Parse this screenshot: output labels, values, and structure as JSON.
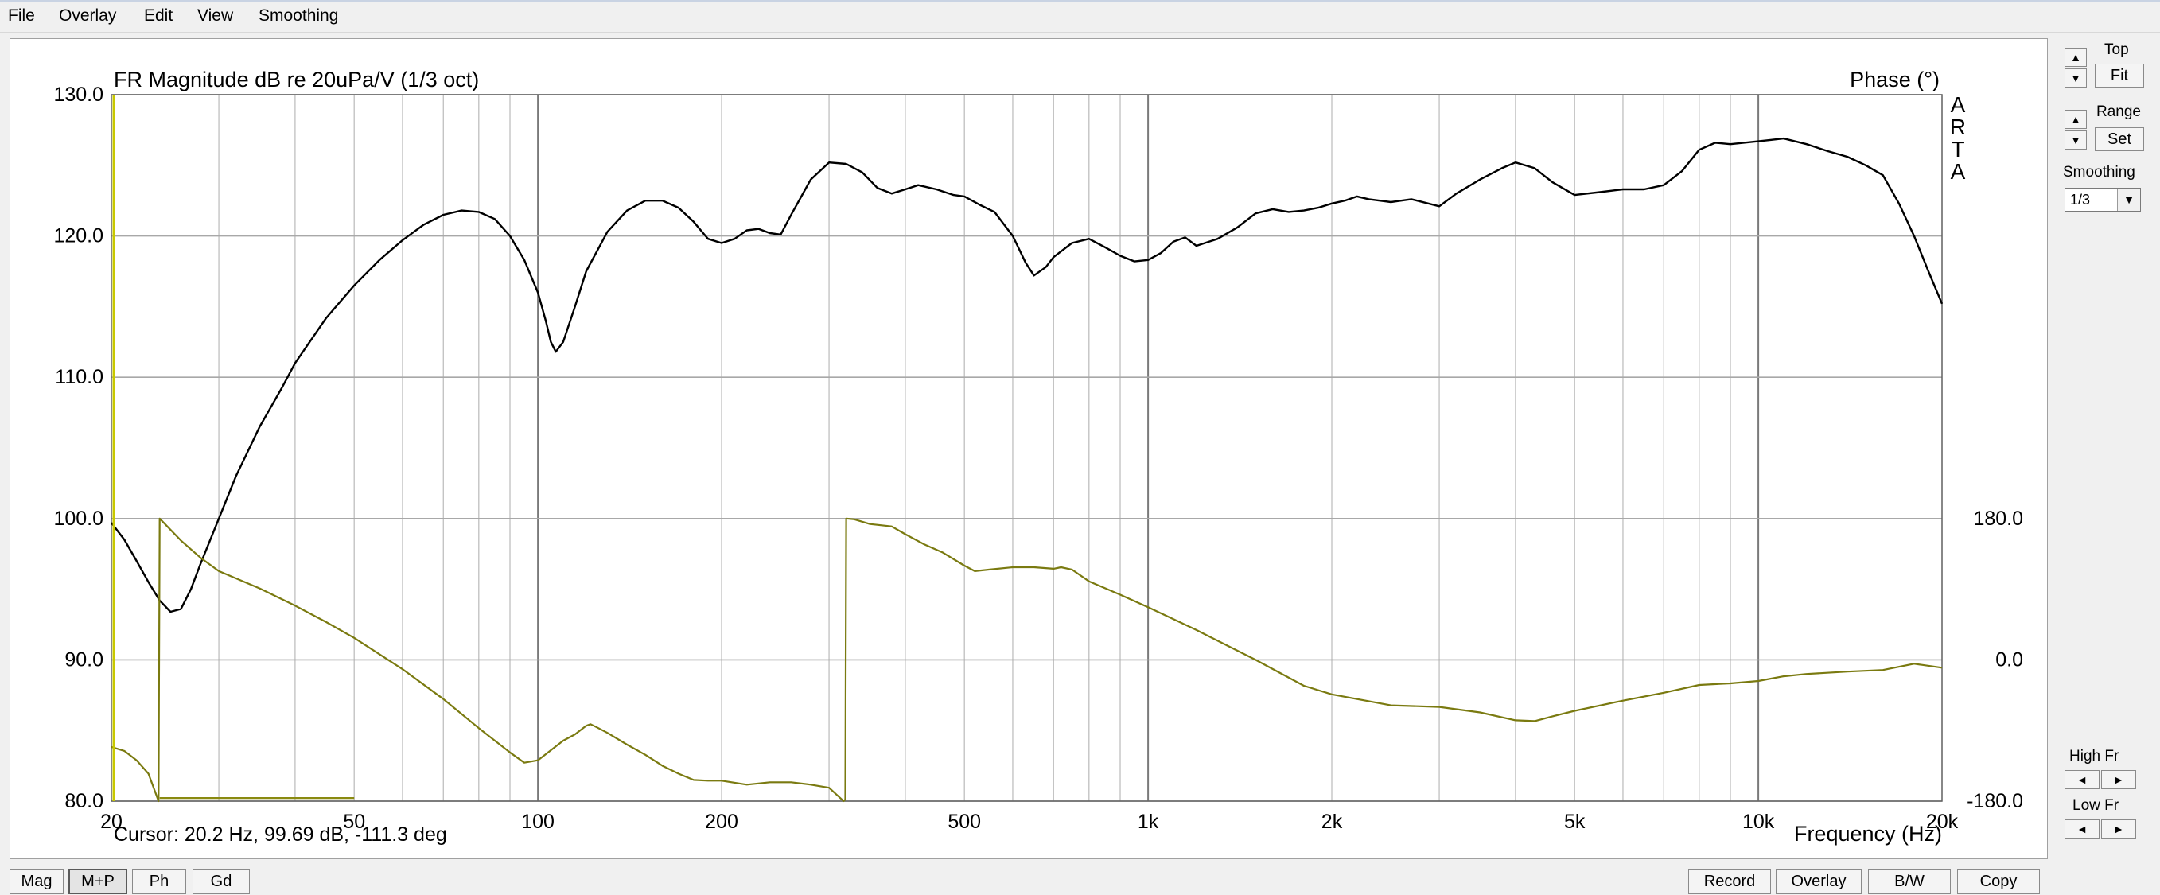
{
  "menu": {
    "items": [
      "File",
      "Overlay",
      "Edit",
      "View",
      "Smoothing"
    ]
  },
  "chart_data": {
    "type": "line",
    "title": "FR Magnitude dB re 20uPa/V (1/3 oct)",
    "right_title": "Phase (°)",
    "xlabel": "Frequency (Hz)",
    "x_scale": "log",
    "xlim": [
      20,
      20000
    ],
    "ylim": [
      80,
      130
    ],
    "y2lim": [
      -180,
      180
    ],
    "grid": true,
    "x_tick_labels": [
      {
        "value": 20,
        "label": "20"
      },
      {
        "value": 50,
        "label": "50"
      },
      {
        "value": 100,
        "label": "100"
      },
      {
        "value": 200,
        "label": "200"
      },
      {
        "value": 500,
        "label": "500"
      },
      {
        "value": 1000,
        "label": "1k"
      },
      {
        "value": 2000,
        "label": "2k"
      },
      {
        "value": 5000,
        "label": "5k"
      },
      {
        "value": 10000,
        "label": "10k"
      },
      {
        "value": 20000,
        "label": "20k"
      }
    ],
    "y_ticks": [
      {
        "value": 130,
        "label": "130.0"
      },
      {
        "value": 120,
        "label": "120.0"
      },
      {
        "value": 110,
        "label": "110.0"
      },
      {
        "value": 100,
        "label": "100.0"
      },
      {
        "value": 90,
        "label": "90.0"
      },
      {
        "value": 80,
        "label": "80.0"
      }
    ],
    "y2_ticks": [
      {
        "value": 180,
        "label": "180.0"
      },
      {
        "value": 0,
        "label": "0.0"
      },
      {
        "value": -180,
        "label": "-180.0"
      }
    ],
    "brand": "ARTA",
    "cursor_text": "Cursor: 20.2 Hz, 99.69 dB, -111.3 deg",
    "cursor_freq": 20,
    "series": [
      {
        "key": "magnitude",
        "color": "#000000",
        "axis": "left",
        "x": [
          20,
          21,
          22,
          23,
          24,
          25,
          26,
          27,
          28,
          30,
          32,
          35,
          38,
          40,
          45,
          50,
          55,
          60,
          65,
          70,
          75,
          80,
          85,
          90,
          95,
          100,
          103,
          105,
          107,
          110,
          115,
          120,
          130,
          140,
          150,
          160,
          170,
          180,
          190,
          200,
          210,
          220,
          230,
          240,
          250,
          260,
          280,
          300,
          320,
          340,
          360,
          380,
          400,
          420,
          450,
          480,
          500,
          530,
          560,
          600,
          630,
          650,
          680,
          700,
          750,
          800,
          850,
          900,
          950,
          1000,
          1050,
          1100,
          1150,
          1200,
          1300,
          1400,
          1500,
          1600,
          1700,
          1800,
          1900,
          2000,
          2100,
          2200,
          2300,
          2500,
          2700,
          3000,
          3200,
          3500,
          3800,
          4000,
          4300,
          4600,
          5000,
          5500,
          6000,
          6500,
          7000,
          7500,
          8000,
          8500,
          9000,
          10000,
          10500,
          11000,
          12000,
          13000,
          14000,
          15000,
          16000,
          17000,
          18000,
          19000,
          20000
        ],
        "y": [
          99.7,
          98.5,
          97,
          95.5,
          94.2,
          93.4,
          93.6,
          95,
          96.8,
          100,
          103,
          106.5,
          109.2,
          111,
          114.2,
          116.5,
          118.3,
          119.7,
          120.8,
          121.5,
          121.8,
          121.7,
          121.2,
          120,
          118.3,
          116,
          114,
          112.5,
          111.8,
          112.5,
          115,
          117.5,
          120.3,
          121.8,
          122.5,
          122.5,
          122,
          121,
          119.8,
          119.5,
          119.8,
          120.4,
          120.5,
          120.2,
          120.1,
          121.5,
          124,
          125.2,
          125.1,
          124.5,
          123.4,
          123,
          123.3,
          123.6,
          123.3,
          122.9,
          122.8,
          122.2,
          121.7,
          120,
          118.1,
          117.2,
          117.8,
          118.5,
          119.5,
          119.8,
          119.2,
          118.6,
          118.2,
          118.3,
          118.8,
          119.6,
          119.9,
          119.3,
          119.8,
          120.6,
          121.6,
          121.9,
          121.7,
          121.8,
          122,
          122.3,
          122.5,
          122.8,
          122.6,
          122.4,
          122.6,
          122.1,
          123,
          124,
          124.8,
          125.2,
          124.8,
          123.8,
          122.9,
          123.1,
          123.3,
          123.3,
          123.6,
          124.6,
          126.1,
          126.6,
          126.5,
          126.7,
          126.8,
          126.9,
          126.5,
          126,
          125.6,
          125,
          124.3,
          122.3,
          120,
          117.5,
          115.2
        ]
      },
      {
        "key": "phase",
        "color": "#7a7a10",
        "axis": "right",
        "x": [
          20,
          21,
          22,
          23,
          23.9,
          24,
          26,
          28,
          30,
          35,
          40,
          45,
          50,
          60,
          70,
          80,
          90,
          95,
          100,
          110,
          115,
          120,
          122,
          125,
          130,
          140,
          150,
          160,
          170,
          180,
          190,
          200,
          220,
          240,
          260,
          280,
          300,
          317,
          319,
          320,
          330,
          350,
          380,
          400,
          430,
          460,
          500,
          520,
          550,
          600,
          650,
          700,
          720,
          750,
          800,
          900,
          1000,
          1200,
          1500,
          1800,
          2000,
          2500,
          3000,
          3500,
          4000,
          4300,
          4600,
          5000,
          6000,
          7000,
          8000,
          9000,
          10000,
          11000,
          12000,
          14000,
          16000,
          18000,
          20000
        ],
        "y": [
          -111,
          -116,
          -128,
          -145,
          -180,
          180,
          152,
          130,
          113,
          91,
          69,
          48,
          28,
          -12,
          -50,
          -87,
          -118,
          -131,
          -128,
          -103,
          -95,
          -84,
          -82,
          -86,
          -93,
          -108,
          -121,
          -135,
          -145,
          -153,
          -154,
          -154,
          -159,
          -156,
          -156,
          -159,
          -163,
          -180,
          -178,
          180,
          179,
          173,
          170,
          160,
          147,
          137,
          120,
          113,
          115,
          118,
          118,
          116,
          118,
          115,
          100,
          83,
          67,
          38,
          0,
          -33,
          -44,
          -58,
          -60,
          -67,
          -77,
          -78,
          -72,
          -65,
          -52,
          -42,
          -32,
          -30,
          -27,
          -21,
          -18,
          -15,
          -13,
          -5,
          -10
        ]
      },
      {
        "key": "phase_floor",
        "color": "#8a8a10",
        "axis": "right",
        "x": [
          24,
          50
        ],
        "y": [
          -176,
          -176
        ]
      }
    ]
  },
  "side_panel": {
    "top_label": "Top",
    "fit_label": "Fit",
    "range_label": "Range",
    "set_label": "Set",
    "smoothing_label": "Smoothing",
    "smoothing_value": "1/3",
    "highfr_label": "High Fr",
    "lowfr_label": "Low Fr"
  },
  "bottom": {
    "mag_label": "Mag",
    "mp_label": "M+P",
    "ph_label": "Ph",
    "gd_label": "Gd",
    "record_label": "Record",
    "overlay_label": "Overlay",
    "bw_label": "B/W",
    "copy_label": "Copy"
  }
}
